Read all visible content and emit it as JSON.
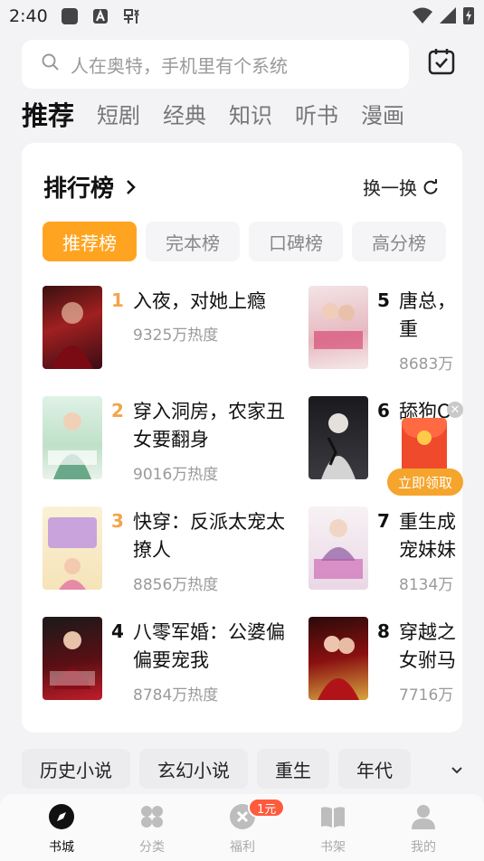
{
  "status_bar": {
    "time": "2:40"
  },
  "search": {
    "placeholder": "人在奥特，手机里有个系统"
  },
  "tabs": [
    {
      "label": "推荐",
      "active": true
    },
    {
      "label": "短剧"
    },
    {
      "label": "经典"
    },
    {
      "label": "知识"
    },
    {
      "label": "听书"
    },
    {
      "label": "漫画"
    }
  ],
  "ranking": {
    "title": "排行榜",
    "refresh_label": "换一换",
    "chips": [
      {
        "label": "推荐榜",
        "active": true
      },
      {
        "label": "完本榜"
      },
      {
        "label": "口碑榜"
      },
      {
        "label": "高分榜"
      }
    ],
    "books": [
      {
        "rank": "1",
        "title": "入夜，对她上瘾",
        "heat": "9325万热度"
      },
      {
        "rank": "2",
        "title": "穿入洞房，农家丑女要翻身",
        "heat": "9016万热度"
      },
      {
        "rank": "3",
        "title": "快穿：反派太宠太撩人",
        "heat": "8856万热度"
      },
      {
        "rank": "4",
        "title": "八零军婚：公婆偏偏要宠我",
        "heat": "8784万热度"
      },
      {
        "rank": "5",
        "title": "唐总，重",
        "heat": "8683万"
      },
      {
        "rank": "6",
        "title": "舔狗O",
        "heat": ""
      },
      {
        "rank": "7",
        "title": "重生成宠妹妹",
        "heat": "8134万"
      },
      {
        "rank": "8",
        "title": "穿越之女驸马",
        "heat": "7716万"
      }
    ]
  },
  "promo": {
    "claim_label": "立即领取"
  },
  "categories": [
    "历史小说",
    "玄幻小说",
    "重生",
    "年代"
  ],
  "bottom_nav": [
    {
      "label": "书城",
      "active": true
    },
    {
      "label": "分类"
    },
    {
      "label": "福利",
      "badge": "1元"
    },
    {
      "label": "书架"
    },
    {
      "label": "我的"
    }
  ],
  "colors": {
    "accent": "#ffa420",
    "top_rank": "#f2a54a",
    "packet": "#f04a2c"
  }
}
